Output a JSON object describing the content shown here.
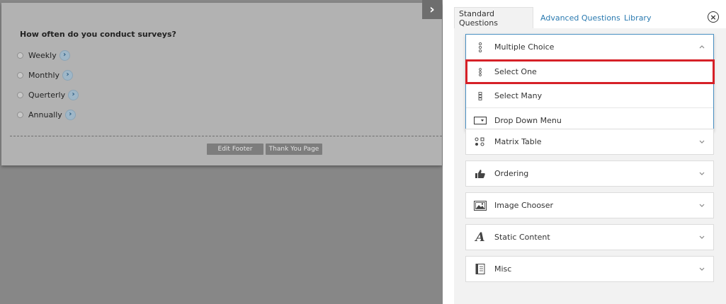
{
  "survey": {
    "question": "How often do you conduct surveys?",
    "options": [
      "Weekly",
      "Monthly",
      "Querterly",
      "Annually"
    ],
    "footer_buttons": {
      "edit_footer": "Edit Footer",
      "thank_you_page": "Thank You Page"
    },
    "collapse_icon": "chevron-right-icon"
  },
  "panel": {
    "tabs": [
      "Standard Questions",
      "Advanced Questions",
      "Library"
    ],
    "active_tab": "Standard Questions",
    "close_icon": "close-circle-icon",
    "multiple_choice": {
      "label": "Multiple Choice",
      "expanded": true,
      "items": [
        {
          "label": "Select One",
          "icon": "radio-list-icon",
          "highlighted": true
        },
        {
          "label": "Select Many",
          "icon": "checkbox-list-icon",
          "highlighted": false
        },
        {
          "label": "Drop Down Menu",
          "icon": "dropdown-icon",
          "highlighted": false
        }
      ]
    },
    "categories": [
      {
        "label": "Matrix Table",
        "icon": "matrix-icon"
      },
      {
        "label": "Ordering",
        "icon": "thumbs-up-icon"
      },
      {
        "label": "Image Chooser",
        "icon": "image-icon"
      },
      {
        "label": "Static Content",
        "icon": "text-a-icon"
      },
      {
        "label": "Misc",
        "icon": "notebook-icon"
      }
    ]
  },
  "colors": {
    "highlight": "#d62027",
    "link": "#2a7ab0",
    "active_border": "#4a90c2"
  }
}
